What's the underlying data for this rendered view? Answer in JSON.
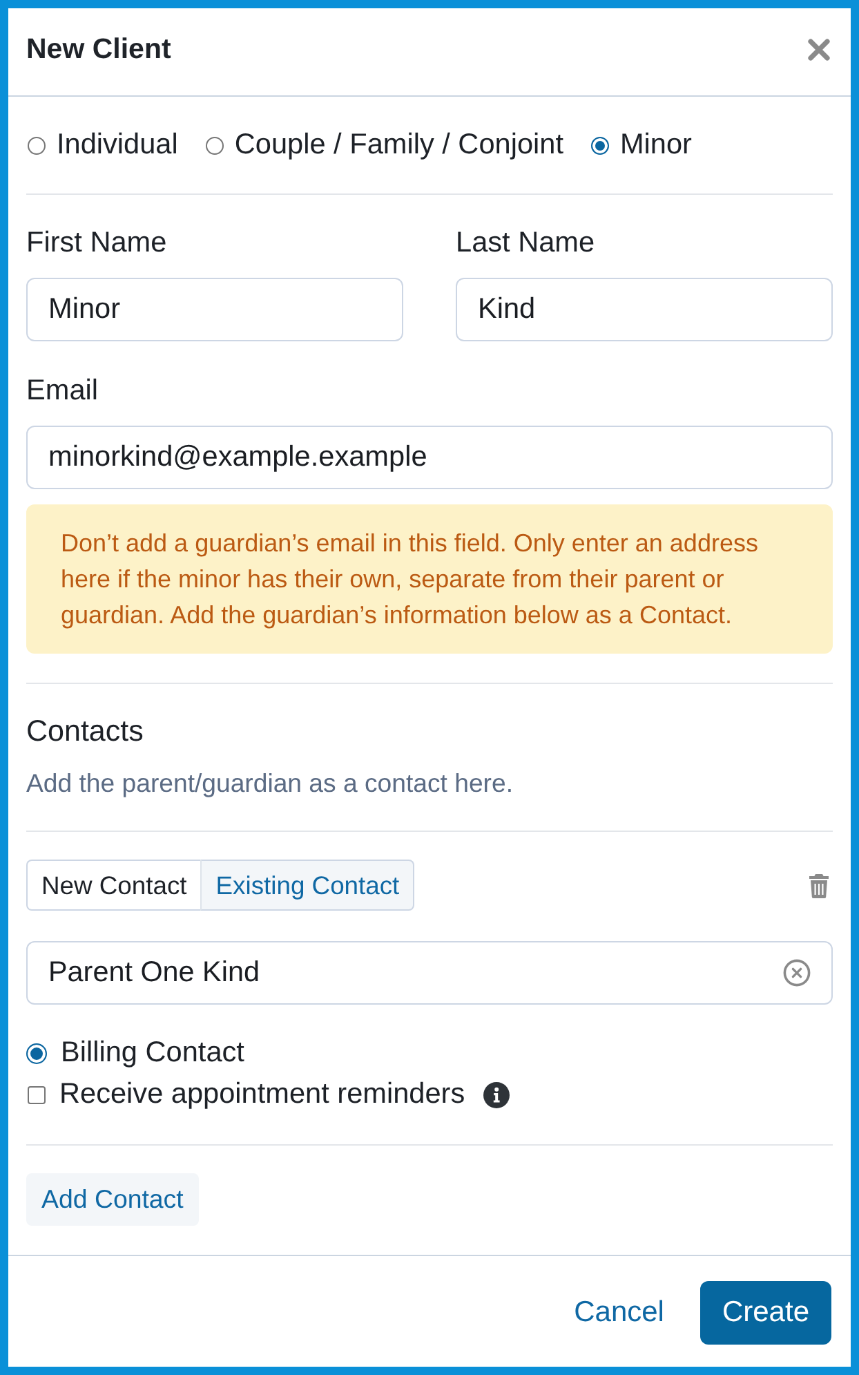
{
  "dialog": {
    "title": "New Client"
  },
  "client_types": [
    {
      "label": "Individual",
      "selected": false
    },
    {
      "label": "Couple / Family / Conjoint",
      "selected": false
    },
    {
      "label": "Minor",
      "selected": true
    }
  ],
  "fields": [
    {
      "label": "First Name",
      "value": "Minor"
    },
    {
      "label": "Last Name",
      "value": "Kind"
    },
    {
      "label": "Email",
      "value": "minorkind@example.example"
    }
  ],
  "warning": "Don’t add a guardian’s email in this field. Only enter an address here if the minor has their own, separate from their parent or guardian. Add the guardian’s information below as a Contact.",
  "contacts": {
    "title": "Contacts",
    "hint": "Add the parent/guardian as a contact here.",
    "tabs": [
      {
        "label": "New Contact",
        "selected": false
      },
      {
        "label": "Existing Contact",
        "selected": true
      }
    ],
    "contact_value": "Parent One Kind",
    "options": [
      {
        "kind": "radio",
        "label": "Billing Contact",
        "checked": true,
        "info": false
      },
      {
        "kind": "checkbox",
        "label": "Receive appointment reminders",
        "checked": false,
        "info": true
      }
    ],
    "add_button": "Add Contact"
  },
  "footer": {
    "buttons": [
      {
        "kind": "link",
        "label": "Cancel"
      },
      {
        "kind": "primary",
        "label": "Create"
      }
    ]
  }
}
